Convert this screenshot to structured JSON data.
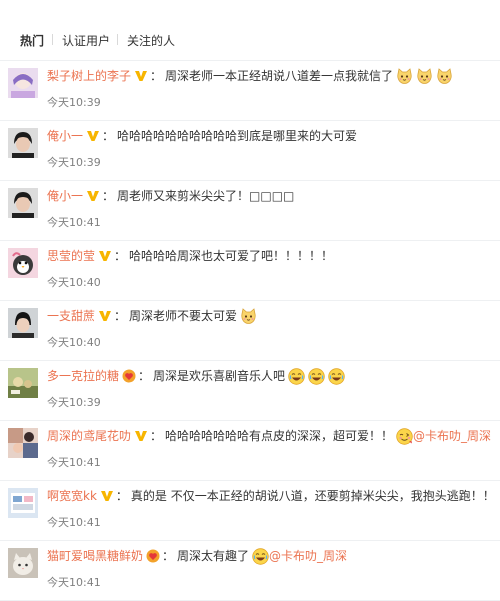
{
  "tabs": [
    {
      "label": "热门",
      "active": true
    },
    {
      "label": "认证用户",
      "active": false
    },
    {
      "label": "关注的人",
      "active": false
    }
  ],
  "comments": [
    {
      "name": "梨子树上的李子",
      "badge": "vip",
      "text": "周深老师一本正经胡说八道差一点我就信了",
      "emojis": [
        "cat-face",
        "cat-face",
        "cat-face"
      ],
      "mention": "",
      "time": "今天10:39"
    },
    {
      "name": "俺小一",
      "badge": "vip",
      "text": "哈哈哈哈哈哈哈哈哈哈到底是哪里来的大可爱",
      "emojis": [],
      "mention": "",
      "time": "今天10:39"
    },
    {
      "name": "俺小一",
      "badge": "vip",
      "text": "周老师又来剪米尖尖了！□□□□",
      "emojis": [],
      "mention": "",
      "time": "今天10:41"
    },
    {
      "name": "思莹的莹",
      "badge": "vip",
      "text": "哈哈哈哈周深也太可爱了吧！！！！！",
      "emojis": [],
      "mention": "",
      "time": "今天10:40"
    },
    {
      "name": "一支甜蔗",
      "badge": "vip",
      "text": "周深老师不要太可爱",
      "emojis": [
        "cat-face"
      ],
      "mention": "",
      "time": "今天10:40"
    },
    {
      "name": "多一克拉的糖",
      "badge": "fan",
      "text": "周深是欢乐喜剧音乐人吧",
      "emojis": [
        "laugh-face",
        "laugh-face",
        "laugh-face"
      ],
      "mention": "",
      "time": "今天10:39"
    },
    {
      "name": "周深的鸢尾花叻",
      "badge": "vip",
      "text": "哈哈哈哈哈哈哈有点皮的深深，超可爱！！",
      "emojis": [
        "wink-face"
      ],
      "mention": "@卡布叻_周深",
      "time": "今天10:41"
    },
    {
      "name": "啊宽宽kk",
      "badge": "vip",
      "text": "真的是 不仅一本正经的胡说八道，还要剪掉米尖尖，我抱头逃跑！！",
      "emojis": [],
      "mention": "",
      "time": "今天10:41"
    },
    {
      "name": "猫町爱喝黑糖鲜奶",
      "badge": "fan",
      "text": "周深太有趣了",
      "emojis": [
        "laugh-face"
      ],
      "mention": "@卡布叻_周深",
      "time": "今天10:41"
    }
  ],
  "colors": {
    "username": "#eb7350",
    "time": "#808080",
    "text": "#333333",
    "badge": "#f7b500"
  }
}
